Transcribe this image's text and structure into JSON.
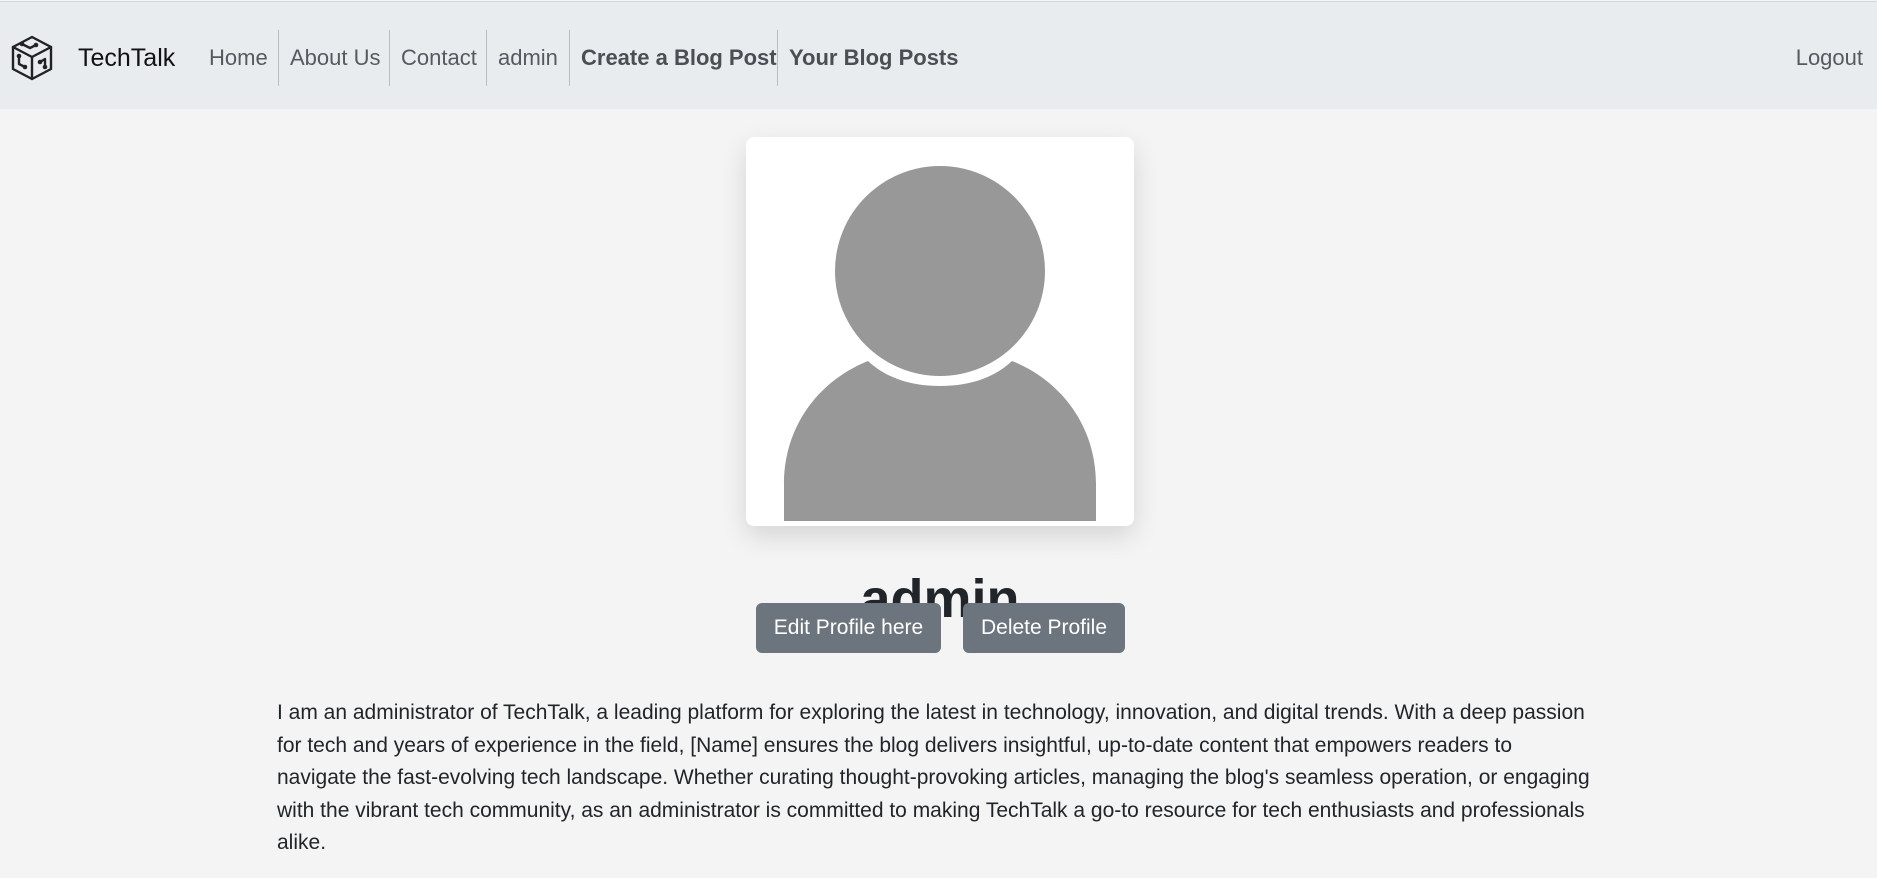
{
  "navbar": {
    "brand": "TechTalk",
    "logo_icon": "circuit-cube-logo-icon",
    "links": [
      {
        "label": "Home"
      },
      {
        "label": "About Us"
      },
      {
        "label": "Contact"
      },
      {
        "label": "admin"
      },
      {
        "label": "Create a Blog Post"
      },
      {
        "label": "Your Blog Posts"
      }
    ],
    "logout": "Logout"
  },
  "profile": {
    "avatar_icon": "default-user-avatar-icon",
    "username": "admin",
    "edit_label": "Edit Profile here",
    "delete_label": "Delete Profile",
    "bio": "I am an administrator of TechTalk, a leading platform for exploring the latest in technology, innovation, and digital trends. With a deep passion for tech and years of experience in the field, [Name] ensures the blog delivers insightful, up-to-date content that empowers readers to navigate the fast-evolving tech landscape. Whether curating thought-provoking articles, managing the blog's seamless operation, or engaging with the vibrant tech community, as an administrator is committed to making TechTalk a go-to resource for tech enthusiasts and professionals alike."
  },
  "colors": {
    "navbar_bg": "#e9ecef",
    "page_bg": "#f4f4f4",
    "button_bg": "#6c757d",
    "avatar_gray": "#989898"
  }
}
